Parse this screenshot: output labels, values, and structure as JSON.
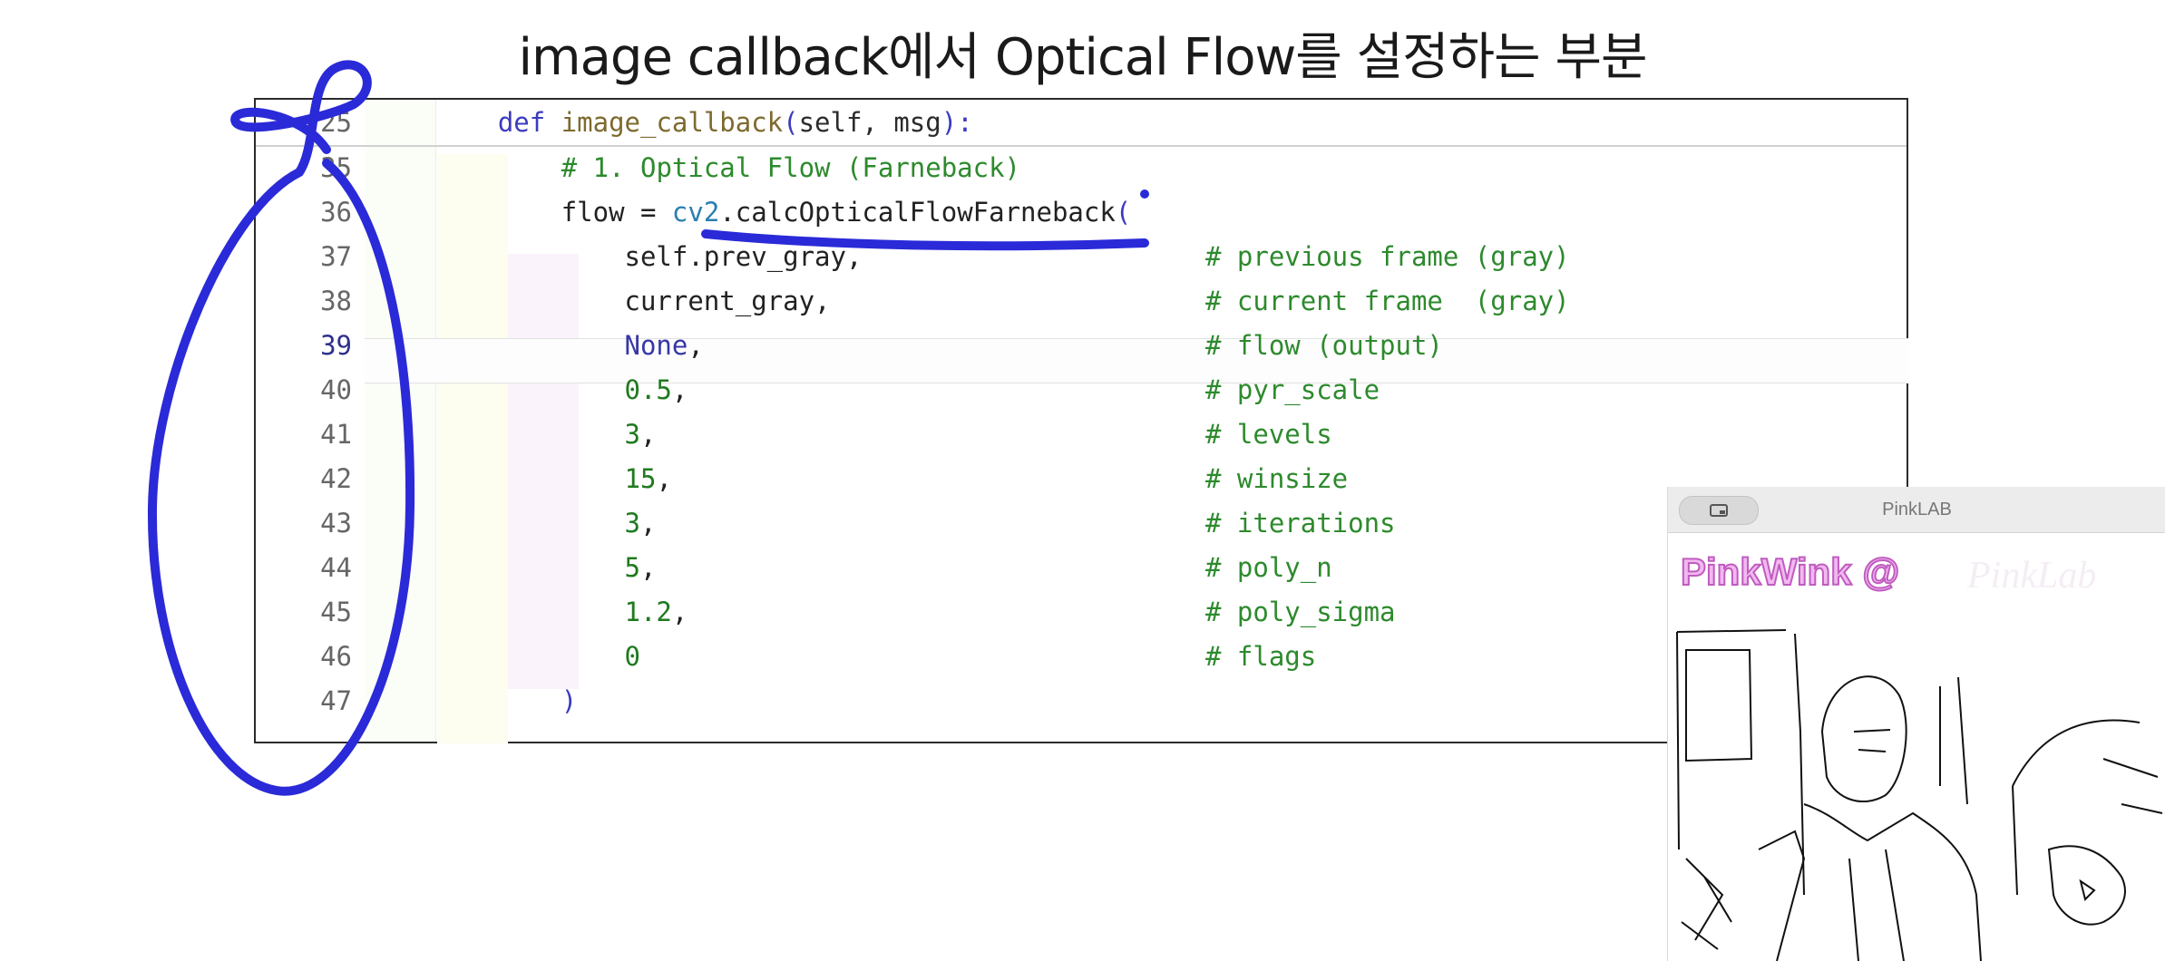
{
  "slide": {
    "title": "image callback에서 Optical Flow를 설정하는 부분"
  },
  "editor": {
    "lines": [
      {
        "number": "25",
        "indent": "    ",
        "parts": [
          {
            "t": "def ",
            "c": "kw"
          },
          {
            "t": "image_callback",
            "c": "fn"
          },
          {
            "t": "(",
            "c": "paren"
          },
          {
            "t": "self, msg",
            "c": "prm"
          },
          {
            "t": "):",
            "c": "paren"
          }
        ],
        "comment": ""
      },
      {
        "number": "35",
        "indent": "        ",
        "parts": [
          {
            "t": "# 1. Optical Flow (Farneback)",
            "c": "com"
          }
        ],
        "comment": ""
      },
      {
        "number": "36",
        "indent": "        ",
        "parts": [
          {
            "t": "flow = ",
            "c": "punc"
          },
          {
            "t": "cv2",
            "c": "mod"
          },
          {
            "t": ".calcOpticalFlowFarneback",
            "c": "punc"
          },
          {
            "t": "(",
            "c": "paren"
          }
        ],
        "comment": ""
      },
      {
        "number": "37",
        "indent": "            ",
        "parts": [
          {
            "t": "self.prev_gray,",
            "c": "punc"
          }
        ],
        "comment": "# previous frame (gray)"
      },
      {
        "number": "38",
        "indent": "            ",
        "parts": [
          {
            "t": "current_gray,",
            "c": "punc"
          }
        ],
        "comment": "# current frame  (gray)"
      },
      {
        "number": "39",
        "indent": "            ",
        "parts": [
          {
            "t": "None",
            "c": "none"
          },
          {
            "t": ",",
            "c": "punc"
          }
        ],
        "comment": "# flow (output)",
        "active": true
      },
      {
        "number": "40",
        "indent": "            ",
        "parts": [
          {
            "t": "0.5",
            "c": "num"
          },
          {
            "t": ",",
            "c": "punc"
          }
        ],
        "comment": "# pyr_scale"
      },
      {
        "number": "41",
        "indent": "            ",
        "parts": [
          {
            "t": "3",
            "c": "num"
          },
          {
            "t": ",",
            "c": "punc"
          }
        ],
        "comment": "# levels"
      },
      {
        "number": "42",
        "indent": "            ",
        "parts": [
          {
            "t": "15",
            "c": "num"
          },
          {
            "t": ",",
            "c": "punc"
          }
        ],
        "comment": "# winsize"
      },
      {
        "number": "43",
        "indent": "            ",
        "parts": [
          {
            "t": "3",
            "c": "num"
          },
          {
            "t": ",",
            "c": "punc"
          }
        ],
        "comment": "# iterations"
      },
      {
        "number": "44",
        "indent": "            ",
        "parts": [
          {
            "t": "5",
            "c": "num"
          },
          {
            "t": ",",
            "c": "punc"
          }
        ],
        "comment": "# poly_n"
      },
      {
        "number": "45",
        "indent": "            ",
        "parts": [
          {
            "t": "1.2",
            "c": "num"
          },
          {
            "t": ",",
            "c": "punc"
          }
        ],
        "comment": "# poly_sigma"
      },
      {
        "number": "46",
        "indent": "            ",
        "parts": [
          {
            "t": "0",
            "c": "num"
          }
        ],
        "comment": "# flags"
      },
      {
        "number": "47",
        "indent": "        ",
        "parts": [
          {
            "t": ")",
            "c": "paren"
          }
        ],
        "comment": ""
      }
    ]
  },
  "video_window": {
    "title": "PinkLAB",
    "brand": "PinkWink @",
    "brand_ghost": "PinkLab",
    "toggle_icon": "picture-in-picture-icon"
  },
  "annotations": {
    "pen_color": "#2a2ad8"
  }
}
